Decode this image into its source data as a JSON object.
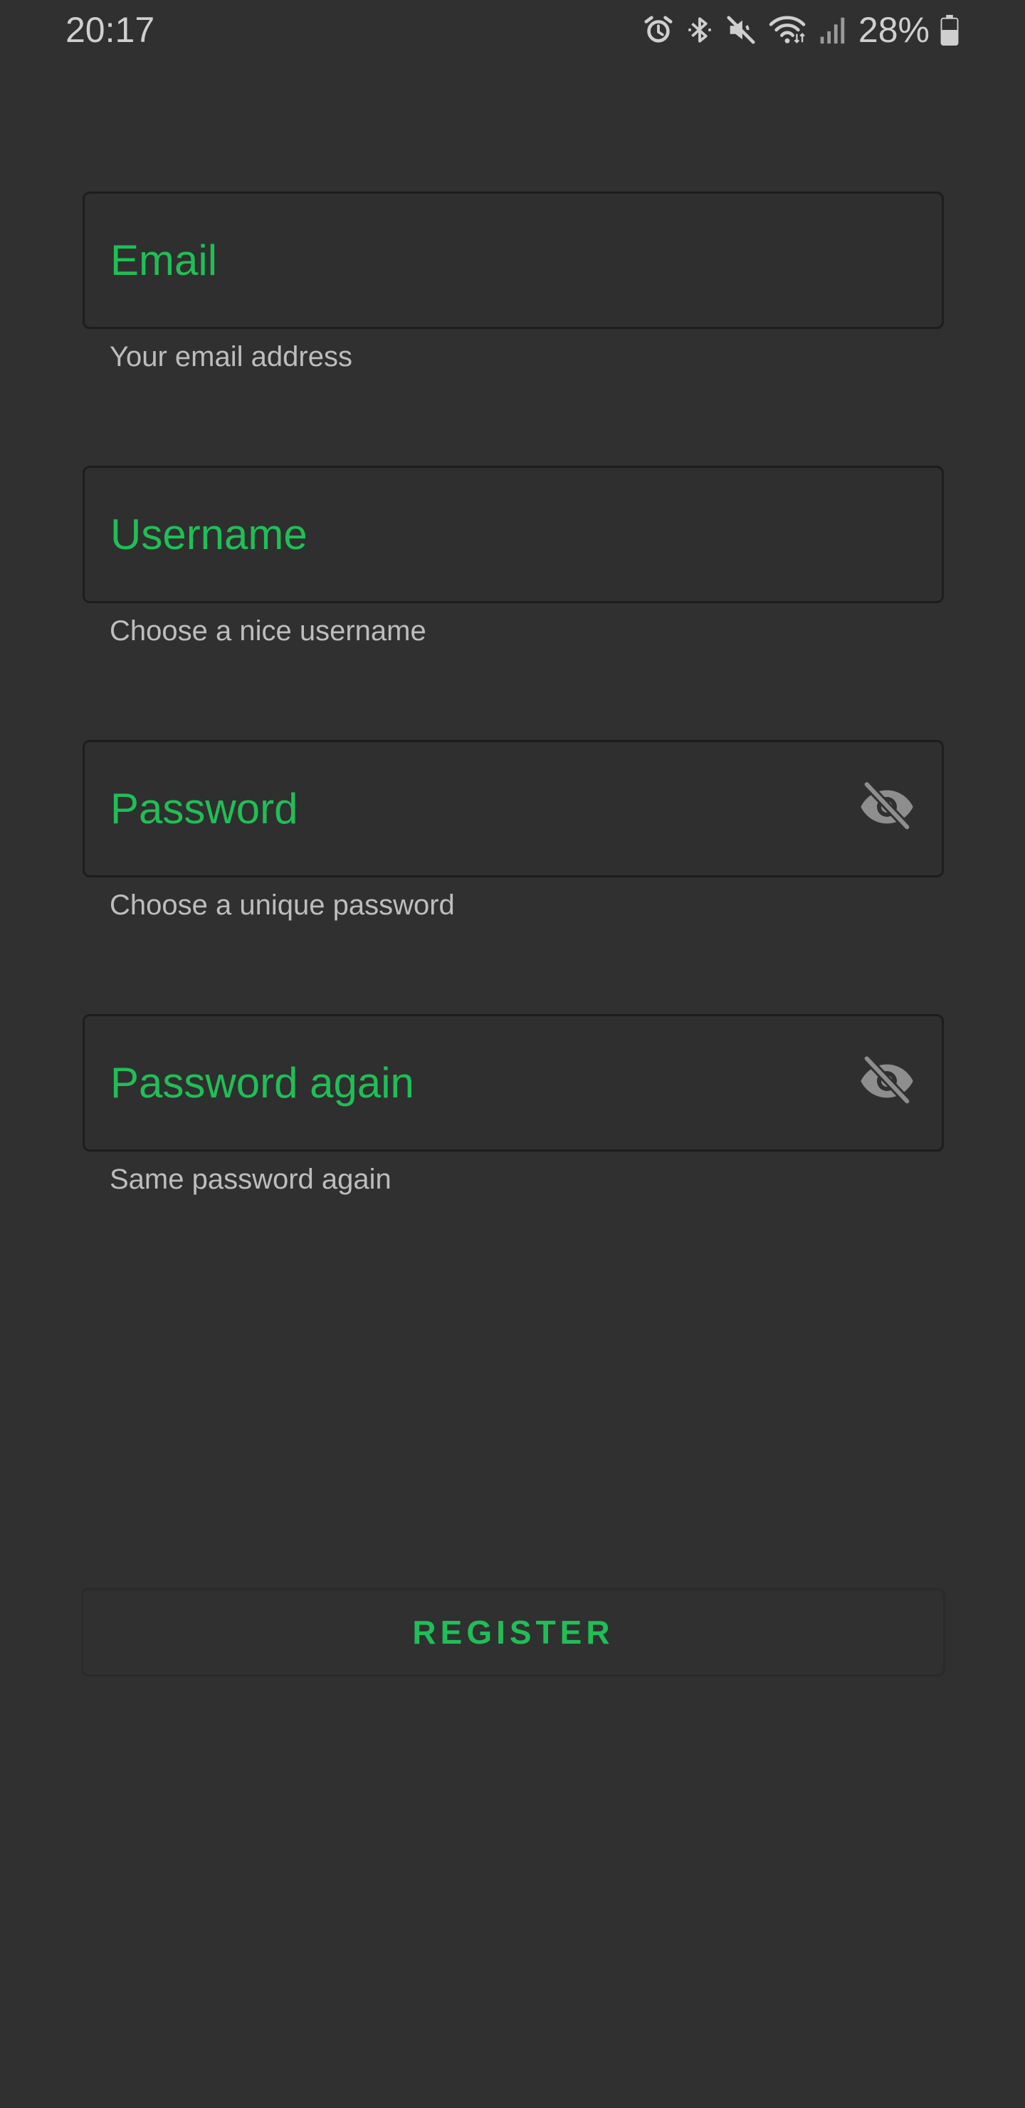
{
  "status_bar": {
    "time": "20:17",
    "battery": "28%",
    "icons": [
      "alarm-icon",
      "bluetooth-icon",
      "mute-icon",
      "wifi-icon",
      "signal-icon",
      "battery-icon"
    ]
  },
  "form": {
    "email": {
      "placeholder": "Email",
      "value": "",
      "helper": "Your email address"
    },
    "username": {
      "placeholder": "Username",
      "value": "",
      "helper": "Choose a nice username"
    },
    "password": {
      "placeholder": "Password",
      "value": "",
      "helper": "Choose a unique password",
      "toggle_icon": "visibility-off-icon"
    },
    "password_again": {
      "placeholder": "Password again",
      "value": "",
      "helper": "Same password again",
      "toggle_icon": "visibility-off-icon"
    },
    "register_label": "REGISTER"
  },
  "colors": {
    "background": "#303030",
    "accent": "#1fbf56",
    "helper_text": "#bdbdbd",
    "status_text": "#cfcfcf",
    "field_border": "#1d1d1d"
  }
}
